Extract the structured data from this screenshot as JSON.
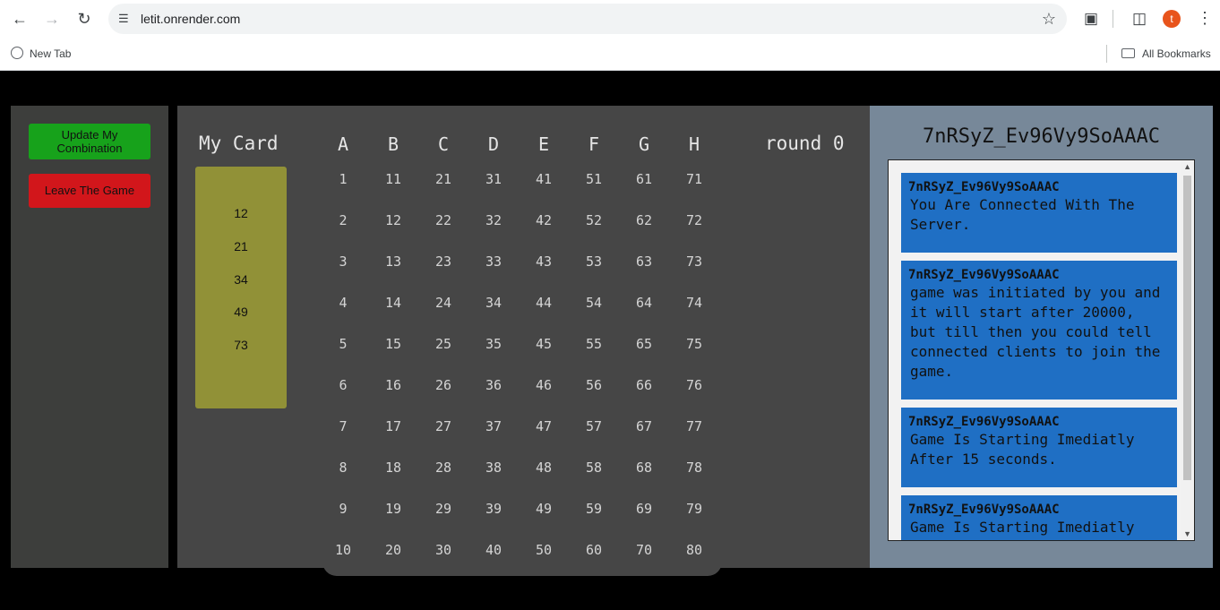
{
  "browser": {
    "url": "letit.onrender.com",
    "profile_initial": "t",
    "bookmarks": [
      {
        "label": "New Tab"
      }
    ],
    "all_bookmarks_label": "All Bookmarks"
  },
  "controls": {
    "update_label": "Update My Combination",
    "leave_label": "Leave The Game"
  },
  "card": {
    "title": "My Card",
    "numbers": [
      "12",
      "21",
      "34",
      "49",
      "73"
    ]
  },
  "board": {
    "columns": [
      "A",
      "B",
      "C",
      "D",
      "E",
      "F",
      "G",
      "H"
    ],
    "rows": [
      [
        "1",
        "11",
        "21",
        "31",
        "41",
        "51",
        "61",
        "71"
      ],
      [
        "2",
        "12",
        "22",
        "32",
        "42",
        "52",
        "62",
        "72"
      ],
      [
        "3",
        "13",
        "23",
        "33",
        "43",
        "53",
        "63",
        "73"
      ],
      [
        "4",
        "14",
        "24",
        "34",
        "44",
        "54",
        "64",
        "74"
      ],
      [
        "5",
        "15",
        "25",
        "35",
        "45",
        "55",
        "65",
        "75"
      ],
      [
        "6",
        "16",
        "26",
        "36",
        "46",
        "56",
        "66",
        "76"
      ],
      [
        "7",
        "17",
        "27",
        "37",
        "47",
        "57",
        "67",
        "77"
      ],
      [
        "8",
        "18",
        "28",
        "38",
        "48",
        "58",
        "68",
        "78"
      ],
      [
        "9",
        "19",
        "29",
        "39",
        "49",
        "59",
        "69",
        "79"
      ],
      [
        "10",
        "20",
        "30",
        "40",
        "50",
        "60",
        "70",
        "80"
      ]
    ]
  },
  "round_label": "round 0",
  "chat": {
    "room_id": "7nRSyZ_Ev96Vy9SoAAAC",
    "messages": [
      {
        "sender": "7nRSyZ_Ev96Vy9SoAAAC",
        "lines": [
          "You Are Connected With The",
          "Server."
        ]
      },
      {
        "sender": "7nRSyZ_Ev96Vy9SoAAAC",
        "lines": [
          "game was initiated by you and",
          "it will start after 20000,",
          "but till then you could tell",
          "connected clients to join the",
          "game."
        ]
      },
      {
        "sender": "7nRSyZ_Ev96Vy9SoAAAC",
        "lines": [
          "Game Is Starting Imediatly",
          "After 15 seconds."
        ]
      },
      {
        "sender": "7nRSyZ_Ev96Vy9SoAAAC",
        "lines": [
          "Game Is Starting Imediatly"
        ]
      }
    ]
  },
  "colors": {
    "update_button": "#17a21b",
    "leave_button": "#d2161b",
    "card_bg": "#919137",
    "message_bg": "#1f6fc4",
    "chat_panel_bg": "#778899"
  }
}
